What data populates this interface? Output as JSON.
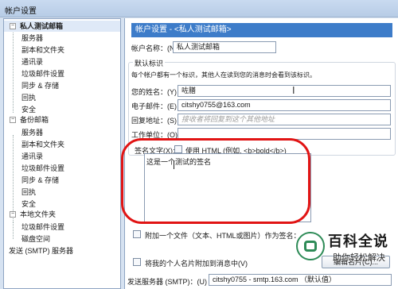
{
  "window": {
    "title": "帐户设置"
  },
  "tree": {
    "items": [
      {
        "label": "私人测试邮箱",
        "bold": true,
        "expander": "−"
      },
      {
        "label": "服务器"
      },
      {
        "label": "副本和文件夹"
      },
      {
        "label": "通讯录"
      },
      {
        "label": "垃圾邮件设置"
      },
      {
        "label": "同步 & 存储"
      },
      {
        "label": "回执"
      },
      {
        "label": "安全"
      },
      {
        "label": "备份邮箱",
        "expander": "−"
      },
      {
        "label": "服务器"
      },
      {
        "label": "副本和文件夹"
      },
      {
        "label": "通讯录"
      },
      {
        "label": "垃圾邮件设置"
      },
      {
        "label": "同步 & 存储"
      },
      {
        "label": "回执"
      },
      {
        "label": "安全"
      },
      {
        "label": "本地文件夹",
        "expander": "−"
      },
      {
        "label": "垃圾邮件设置"
      },
      {
        "label": "磁盘空间"
      },
      {
        "label": "发送 (SMTP) 服务器"
      }
    ]
  },
  "main": {
    "header": "帐户设置 - <私人测试邮箱>",
    "account_name_label": "帐户名称：(N)",
    "account_name_value": "私人测试邮箱",
    "default_identity": {
      "title": "默认标识",
      "description": "每个帐户都有一个标识，其他人在读到您的消息时会看到该标识。",
      "name_label": "您的姓名：(Y)",
      "name_value": "咗膳",
      "email_label": "电子邮件：(E)",
      "email_value": "citshy0755@163.com",
      "reply_label": "回复地址：(S)",
      "reply_placeholder": "接收者将回复到这个其他地址",
      "org_label": "工作单位：(O)",
      "org_value": ""
    },
    "signature": {
      "label": "签名文字(X):",
      "html_option": "使用 HTML (例如, <b>bold</b>)",
      "text": "这是一个测试的签名"
    },
    "attach_file_label": "附加一个文件（文本、HTML或图片）作为签名：",
    "attach_vcard_label": "将我的个人名片附加到消息中(V)",
    "edit_card_button": "编辑名片(C)...",
    "smtp_label": "发送服务器 (SMTP)：(U)",
    "smtp_value": "citshy0755 - smtp.163.com （默认值）"
  },
  "watermark": {
    "big": "百科全说",
    "small": "助你轻松解决"
  },
  "colors": {
    "header": "#3d7cc9",
    "ring": "#e11414"
  }
}
